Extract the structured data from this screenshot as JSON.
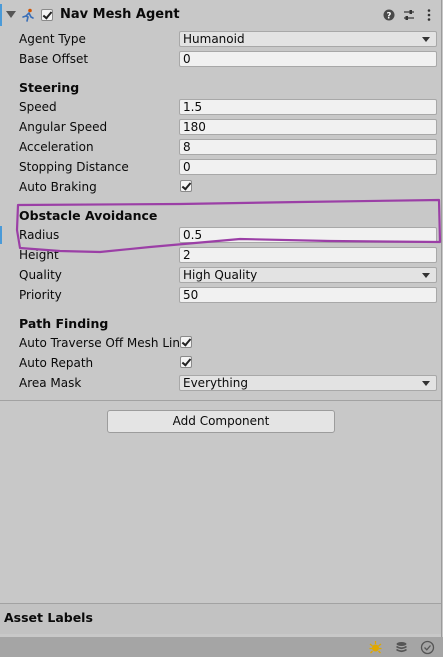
{
  "component": {
    "title": "Nav Mesh Agent",
    "enabled": true,
    "icons": [
      "foldout-arrow-icon",
      "navmesh-agent-icon",
      "help-icon",
      "presets-icon",
      "more-icon"
    ]
  },
  "agent_fields": [
    {
      "label": "Agent Type",
      "value": "Humanoid",
      "kind": "dropdown"
    },
    {
      "label": "Base Offset",
      "value": "0",
      "kind": "input"
    }
  ],
  "steering": {
    "header": "Steering",
    "fields": [
      {
        "label": "Speed",
        "value": "1.5"
      },
      {
        "label": "Angular Speed",
        "value": "180"
      },
      {
        "label": "Acceleration",
        "value": "8"
      },
      {
        "label": "Stopping Distance",
        "value": "0"
      }
    ],
    "auto_braking": {
      "label": "Auto Braking",
      "checked": true
    }
  },
  "obstacle_avoidance": {
    "header": "Obstacle Avoidance",
    "radius": {
      "label": "Radius",
      "value": "0.5"
    },
    "height": {
      "label": "Height",
      "value": "2"
    },
    "quality": {
      "label": "Quality",
      "value": "High Quality"
    },
    "priority": {
      "label": "Priority",
      "value": "50"
    }
  },
  "path_finding": {
    "header": "Path Finding",
    "auto_traverse": {
      "label": "Auto Traverse Off Mesh Link",
      "checked": true
    },
    "auto_repath": {
      "label": "Auto Repath",
      "checked": true
    },
    "area_mask": {
      "label": "Area Mask",
      "value": "Everything"
    }
  },
  "add_component_label": "Add Component",
  "asset_labels_title": "Asset Labels",
  "colors": {
    "panel": "#c8c8c8",
    "accent": "#4a9ad8",
    "annotation": "#9b3fa6"
  }
}
